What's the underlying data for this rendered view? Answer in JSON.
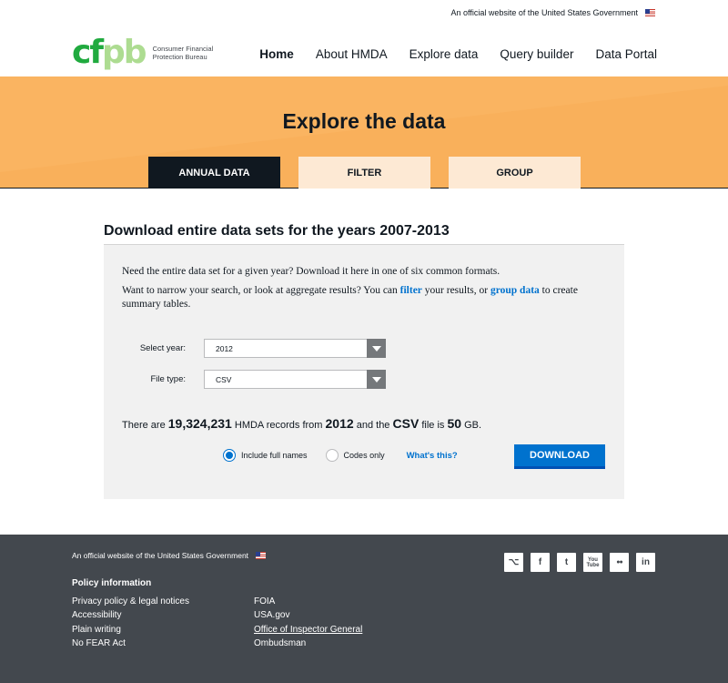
{
  "gov_banner": {
    "text": "An official website of the United States Government"
  },
  "logo": {
    "mark": "cfpb",
    "text": "Consumer Financial Protection Bureau"
  },
  "nav": {
    "items": [
      {
        "label": "Home",
        "active": true
      },
      {
        "label": "About HMDA",
        "active": false
      },
      {
        "label": "Explore data",
        "active": false
      },
      {
        "label": "Query builder",
        "active": false
      },
      {
        "label": "Data Portal",
        "active": false
      }
    ]
  },
  "hero": {
    "title": "Explore the data",
    "tabs": [
      {
        "label": "ANNUAL DATA",
        "active": true
      },
      {
        "label": "FILTER",
        "active": false
      },
      {
        "label": "GROUP",
        "active": false
      }
    ]
  },
  "section": {
    "title": "Download entire data sets for the years 2007-2013",
    "intro1": "Need the entire data set for a given year? Download it here in one of six common formats.",
    "intro2_a": "Want to narrow your search, or look at aggregate results? You can ",
    "filter_link": "filter",
    "intro2_b": " your results, or ",
    "group_link": "group data",
    "intro2_c": " to create summary tables.",
    "year_label": "Select year:",
    "year_value": "2012",
    "type_label": "File type:",
    "type_value": "CSV",
    "summary": {
      "pre": "There are ",
      "count": "19,324,231",
      "mid1": " HMDA records from ",
      "year": "2012",
      "mid2": " and the ",
      "format": "CSV",
      "mid3": " file is ",
      "size": "50",
      "unit": " GB."
    },
    "option_full": "Include full names",
    "option_codes": "Codes only",
    "whats_this": "What's this?",
    "download": "DOWNLOAD"
  },
  "footer": {
    "banner": "An official website of the United States Government",
    "policy_heading": "Policy information",
    "col1": [
      "Privacy policy & legal notices",
      "Accessibility",
      "Plain writing",
      "No FEAR Act"
    ],
    "col2": [
      "FOIA",
      "USA.gov",
      "Office of Inspector General",
      "Ombudsman"
    ],
    "social": [
      {
        "icon": "github-icon",
        "glyph": "⌥"
      },
      {
        "icon": "facebook-icon",
        "glyph": "f"
      },
      {
        "icon": "twitter-icon",
        "glyph": "t"
      },
      {
        "icon": "youtube-icon",
        "glyph": "You Tube"
      },
      {
        "icon": "flickr-icon",
        "glyph": "●●"
      },
      {
        "icon": "linkedin-icon",
        "glyph": "in"
      }
    ]
  },
  "colors": {
    "accent": "#0072ce",
    "hero": "#f9b05b",
    "dark": "#101820",
    "footer": "#43484e"
  }
}
